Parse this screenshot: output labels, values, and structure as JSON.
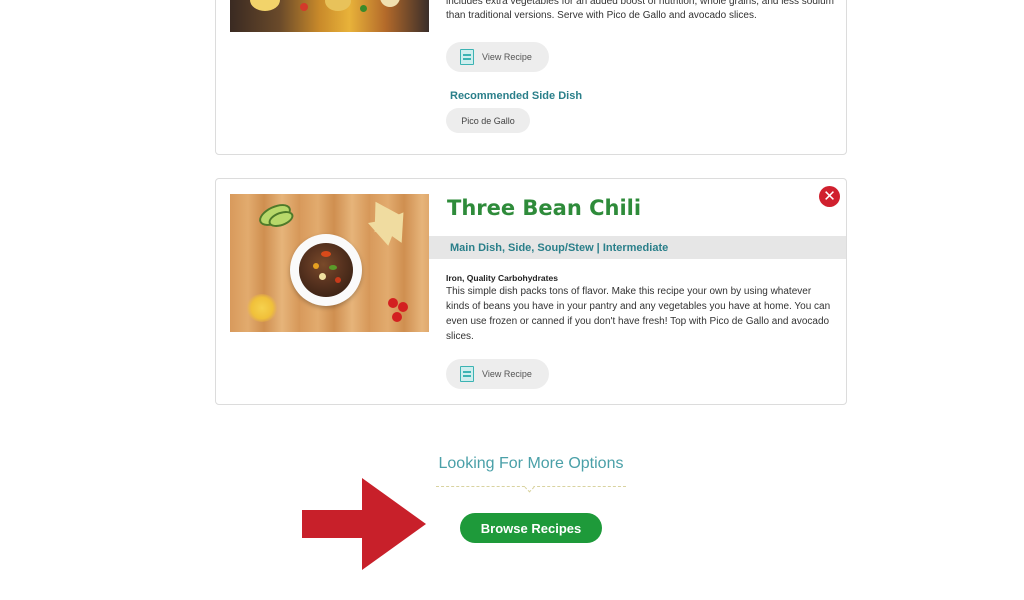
{
  "recipe_prev": {
    "description": "includes extra vegetables for an added boost of nutrition, whole grains, and less sodium than traditional versions. Serve with Pico de Gallo and avocado slices.",
    "view_recipe_label": "View Recipe",
    "side_dish_heading": "Recommended Side Dish",
    "side_dish_tag": "Pico de Gallo"
  },
  "recipe": {
    "title": "Three Bean Chili",
    "categories": "Main Dish, Side, Soup/Stew | Intermediate",
    "nutrients": "Iron, Quality Carbohydrates",
    "description": "This simple dish packs tons of flavor. Make this recipe your own by using whatever kinds of beans you have in your pantry and any vegetables you have at home. You can even use frozen or canned if you don't have fresh! Top with Pico de Gallo and avocado slices.",
    "view_recipe_label": "View Recipe",
    "remove_icon": "close-icon"
  },
  "more_options": {
    "heading": "Looking For More Options",
    "browse_label": "Browse Recipes"
  },
  "colors": {
    "title_green": "#2e8b3a",
    "teal": "#2a7f8a",
    "button_green": "#1e9a3a",
    "remove_red": "#d0202e",
    "arrow_red": "#c8202a"
  }
}
